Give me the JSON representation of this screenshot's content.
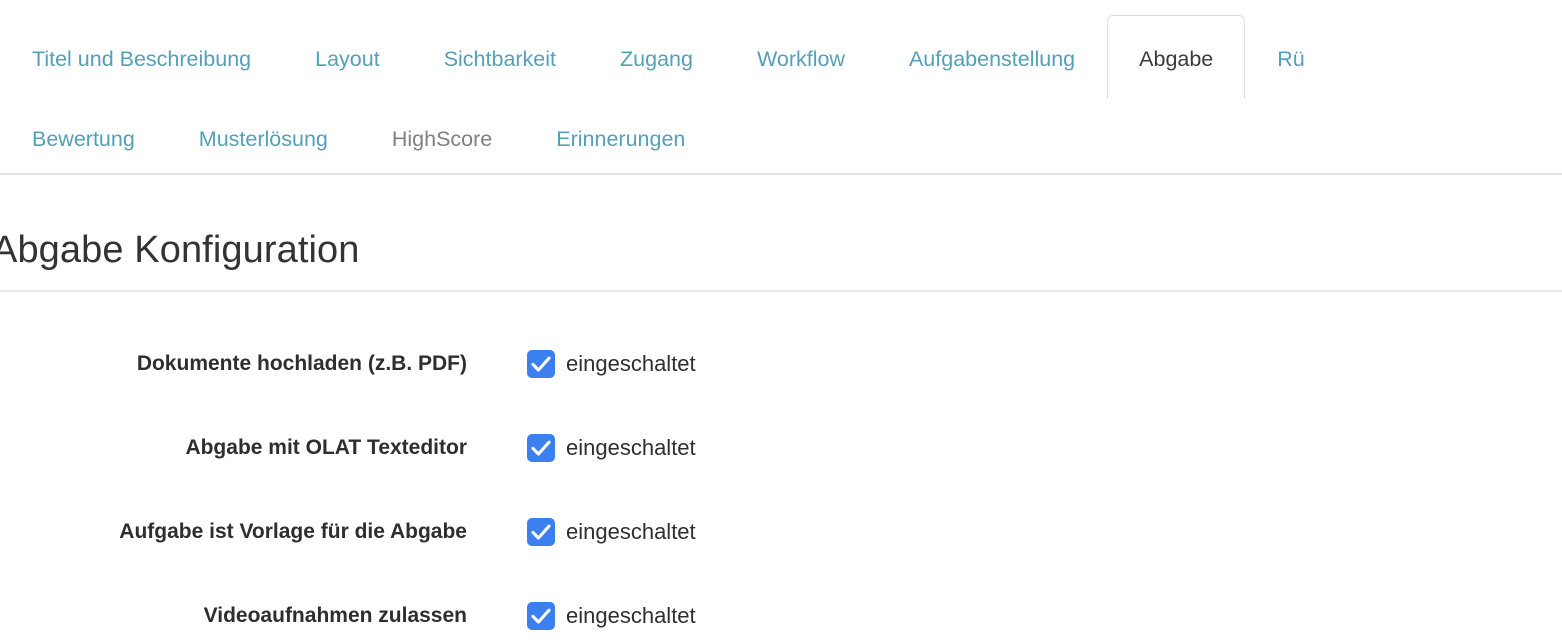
{
  "tabs": {
    "row1": [
      {
        "label": "Titel und Beschreibung",
        "state": "link"
      },
      {
        "label": "Layout",
        "state": "link"
      },
      {
        "label": "Sichtbarkeit",
        "state": "link"
      },
      {
        "label": "Zugang",
        "state": "link"
      },
      {
        "label": "Workflow",
        "state": "link"
      },
      {
        "label": "Aufgabenstellung",
        "state": "link"
      },
      {
        "label": "Abgabe",
        "state": "active"
      },
      {
        "label": "Rü",
        "state": "link"
      }
    ],
    "row2": [
      {
        "label": "Bewertung",
        "state": "link"
      },
      {
        "label": "Musterlösung",
        "state": "link"
      },
      {
        "label": "HighScore",
        "state": "disabled"
      },
      {
        "label": "Erinnerungen",
        "state": "link"
      }
    ]
  },
  "section": {
    "title": "Abgabe Konfiguration"
  },
  "form": {
    "rows": [
      {
        "label": "Dokumente hochladen (z.B. PDF)",
        "value": "eingeschaltet",
        "checked": true
      },
      {
        "label": "Abgabe mit OLAT Texteditor",
        "value": "eingeschaltet",
        "checked": true
      },
      {
        "label": "Aufgabe ist Vorlage für die Abgabe",
        "value": "eingeschaltet",
        "checked": true
      },
      {
        "label": "Videoaufnahmen zulassen",
        "value": "eingeschaltet",
        "checked": true
      }
    ]
  },
  "colors": {
    "link": "#54a0b8",
    "disabled": "#808080",
    "active_tab_text": "#3b3b3b",
    "checkbox_blue": "#3b7ff0",
    "border": "#e2e2e2"
  }
}
